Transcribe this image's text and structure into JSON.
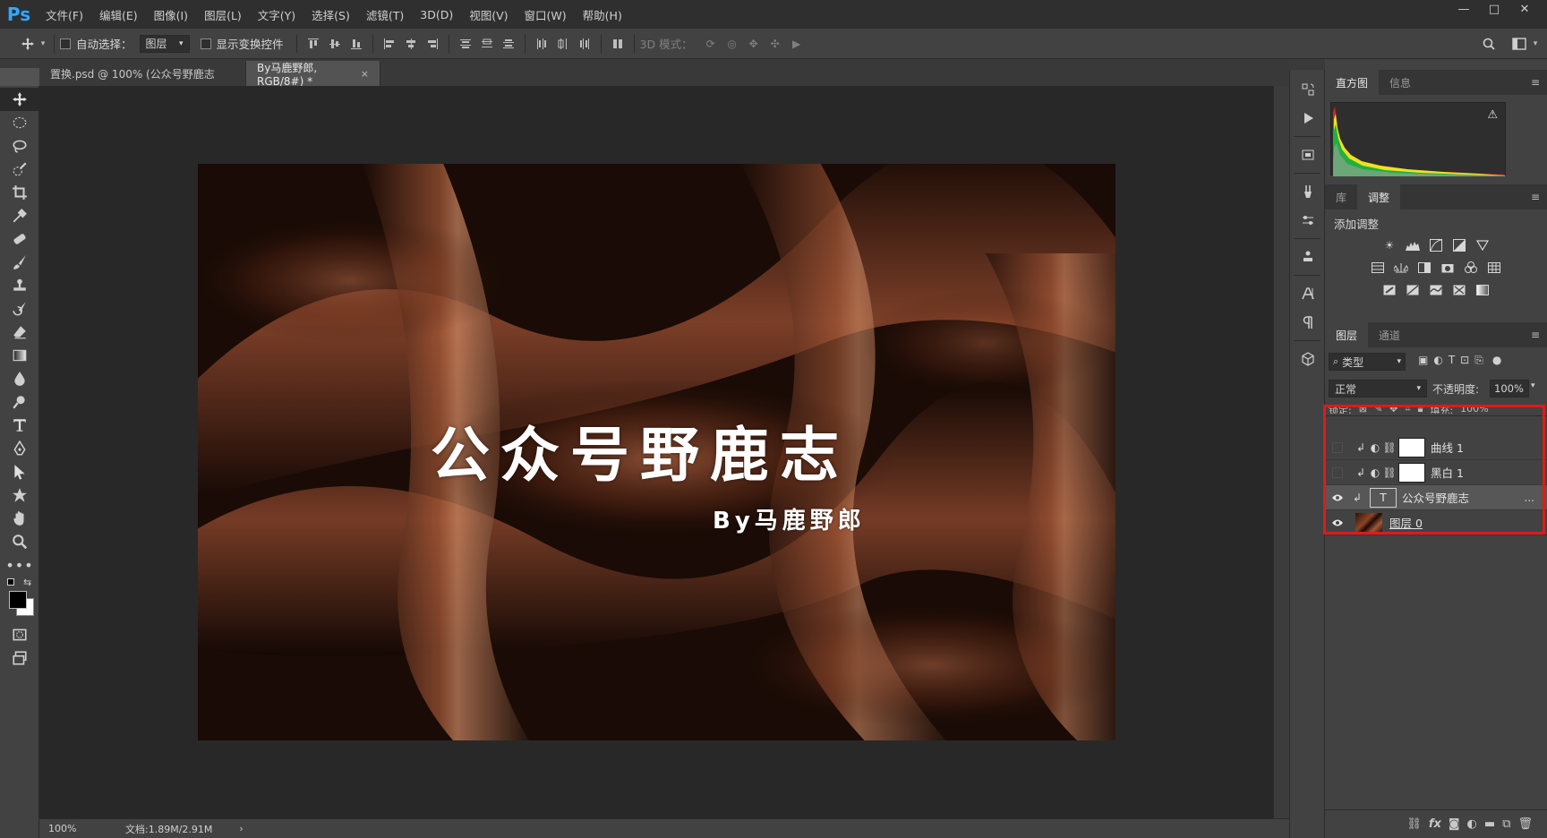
{
  "app": {
    "logo": "Ps"
  },
  "menu": [
    "文件(F)",
    "编辑(E)",
    "图像(I)",
    "图层(L)",
    "文字(Y)",
    "选择(S)",
    "滤镜(T)",
    "3D(D)",
    "视图(V)",
    "窗口(W)",
    "帮助(H)"
  ],
  "window_controls": {
    "minimize": "—",
    "restore": "□",
    "close": "✕"
  },
  "options": {
    "auto_select_label": "自动选择：",
    "auto_select_value": "图层",
    "show_transform_label": "显示变换控件",
    "mode_3d_label": "3D 模式："
  },
  "tabs": [
    {
      "label": "置换.psd @ 100% (公众号野鹿志",
      "active": false
    },
    {
      "label": "By马鹿野郎, RGB/8#) *",
      "active": true,
      "close": "×"
    }
  ],
  "canvas": {
    "title": "公众号野鹿志",
    "subtitle": "By马鹿野郎"
  },
  "status": {
    "zoom": "100%",
    "doc_info": "文档:1.89M/2.91M",
    "arrow": "›"
  },
  "panels": {
    "top_tabs": [
      "直方图",
      "信息"
    ],
    "mid_tabs": [
      "库",
      "调整"
    ],
    "adjust_title": "添加调整",
    "layer_tabs": [
      "图层",
      "通道"
    ],
    "filter_kind": "类型",
    "blend_mode": "正常",
    "opacity_label": "不透明度:",
    "opacity_value": "100%",
    "lock_label": "锁定:",
    "fill_label": "填充:",
    "fill_value": "100%"
  },
  "layers": [
    {
      "name": "曲线 1",
      "visible": false,
      "kind": "adjustment"
    },
    {
      "name": "黑白 1",
      "visible": false,
      "kind": "adjustment"
    },
    {
      "name": "公众号野鹿志",
      "visible": true,
      "kind": "text",
      "selected": true,
      "more": "..."
    },
    {
      "name": "图层 0",
      "visible": true,
      "kind": "image"
    }
  ],
  "colors": {
    "highlight_box": "#e01a1a",
    "ps_blue": "#31a8ff"
  }
}
